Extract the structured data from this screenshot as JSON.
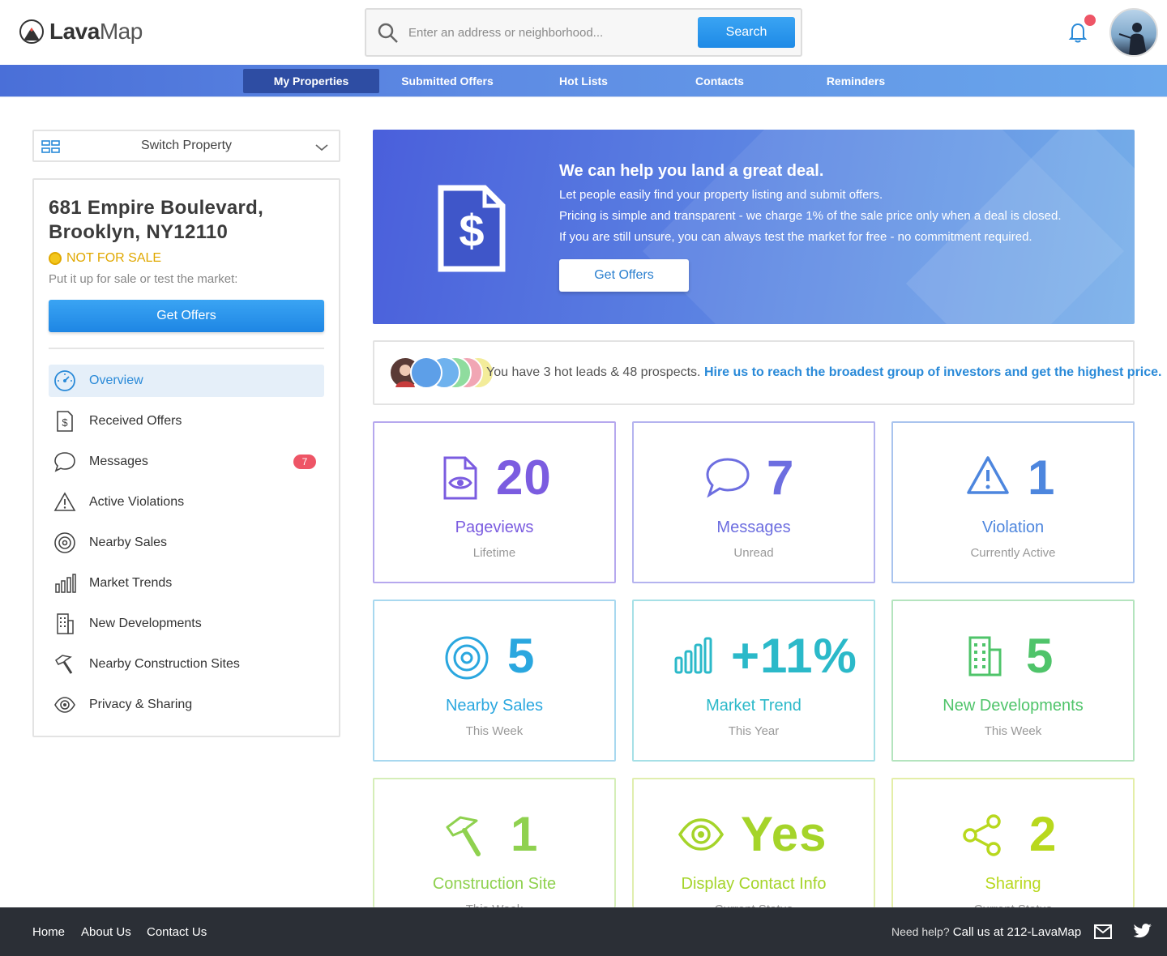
{
  "header": {
    "logo_part1": "Lava",
    "logo_part2": "Map",
    "search_placeholder": "Enter an address or neighborhood...",
    "search_button": "Search"
  },
  "nav": {
    "items": [
      {
        "label": "My Properties",
        "active": true
      },
      {
        "label": "Submitted Offers"
      },
      {
        "label": "Hot Lists"
      },
      {
        "label": "Contacts"
      },
      {
        "label": "Reminders"
      }
    ]
  },
  "sidebar": {
    "switch_label": "Switch Property",
    "address": "681 Empire Boulevard, Brooklyn, NY12110",
    "status": "NOT FOR SALE",
    "subtext": "Put it up for sale or test the market:",
    "get_offers": "Get Offers",
    "menu": [
      {
        "label": "Overview",
        "icon": "gauge-icon",
        "active": true
      },
      {
        "label": "Received Offers",
        "icon": "dollar-doc-icon"
      },
      {
        "label": "Messages",
        "icon": "chat-bubble-icon",
        "badge": "7"
      },
      {
        "label": "Active Violations",
        "icon": "warning-icon"
      },
      {
        "label": "Nearby Sales",
        "icon": "target-icon"
      },
      {
        "label": "Market Trends",
        "icon": "bar-chart-icon"
      },
      {
        "label": "New Developments",
        "icon": "building-icon"
      },
      {
        "label": "Nearby Construction Sites",
        "icon": "hammer-icon"
      },
      {
        "label": "Privacy & Sharing",
        "icon": "eye-icon"
      }
    ]
  },
  "banner": {
    "title": "We can help you land a great deal.",
    "line1": "Let people easily find your property listing and submit offers.",
    "line2": "Pricing is simple and transparent - we charge 1% of the sale price only when a deal is closed.",
    "line3": "If you are still unsure, you can always test the market for free - no commitment required.",
    "button": "Get Offers"
  },
  "leads": {
    "text": "You have 3 hot leads & 48 prospects.",
    "link": "Hire us to reach the broadest group of investors and get the highest price."
  },
  "cards": [
    {
      "value": "20",
      "label": "Pageviews",
      "sub": "Lifetime",
      "color": "#7b5ce0",
      "icon": "doc-eye-icon"
    },
    {
      "value": "7",
      "label": "Messages",
      "sub": "Unread",
      "color": "#6d6ee0",
      "icon": "chat-bubble-icon"
    },
    {
      "value": "1",
      "label": "Violation",
      "sub": "Currently Active",
      "color": "#4d86de",
      "icon": "warning-icon"
    },
    {
      "value": "5",
      "label": "Nearby Sales",
      "sub": "This Week",
      "color": "#2aa7df",
      "icon": "target-icon"
    },
    {
      "value": "+11%",
      "label": "Market Trend",
      "sub": "This Year",
      "color": "#2bb9c9",
      "icon": "bar-chart-icon"
    },
    {
      "value": "5",
      "label": "New Developments",
      "sub": "This Week",
      "color": "#4fc46a",
      "icon": "building-icon"
    },
    {
      "value": "1",
      "label": "Construction Site",
      "sub": "This Week",
      "color": "#8fd14f",
      "icon": "hammer-icon"
    },
    {
      "value": "Yes",
      "label": "Display Contact Info",
      "sub": "Current Status",
      "color": "#a5d42a",
      "icon": "eye-icon"
    },
    {
      "value": "2",
      "label": "Sharing",
      "sub": "Current Status",
      "color": "#b8d81e",
      "icon": "share-icon"
    }
  ],
  "footer": {
    "links": [
      "Home",
      "About Us",
      "Contact Us"
    ],
    "help_label": "Need help?",
    "help_phone": "Call us at 212-LavaMap"
  }
}
